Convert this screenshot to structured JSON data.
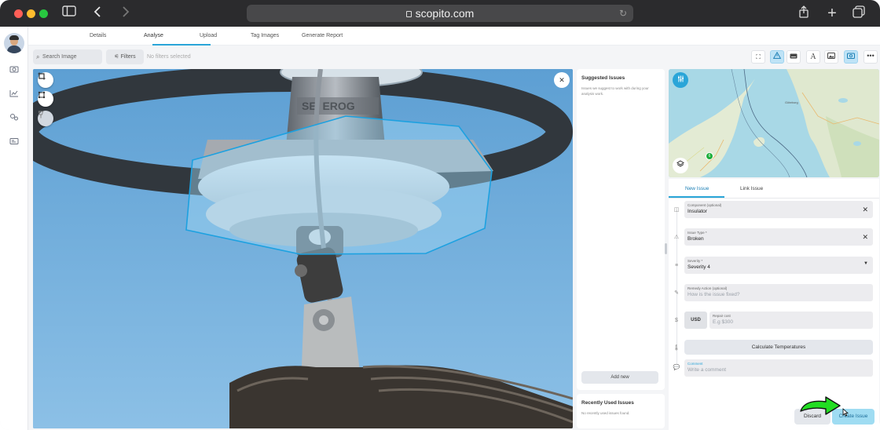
{
  "browser": {
    "url": "scopito.com"
  },
  "tabs": [
    "Details",
    "Analyse",
    "Upload",
    "Tag Images",
    "Generate Report"
  ],
  "toolbar": {
    "search_placeholder": "Search Image",
    "filters_label": "Filters",
    "no_filters": "No filters selected",
    "text_tool": "A"
  },
  "suggested": {
    "title": "Suggested Issues",
    "description": "Issues we suggest to work with during your analysis work.",
    "add_new": "Add new"
  },
  "recent": {
    "title": "Recently Used Issues",
    "description": "No recently used issues found."
  },
  "map": {
    "marker_count": "6",
    "place_label": "Göteborg"
  },
  "issue_form": {
    "tab_new": "New Issue",
    "tab_link": "Link Issue",
    "component_label": "Component (optional)",
    "component_value": "Insulator",
    "issue_type_label": "Issue Type *",
    "issue_type_value": "Broken",
    "severity_label": "Severity *",
    "severity_value": "Severity 4",
    "remedy_label": "Remedy Action (optional)",
    "remedy_placeholder": "How is the issue fixed?",
    "currency": "USD",
    "repair_cost_label": "Repair cost",
    "repair_cost_placeholder": "E.g $300",
    "calculate_label": "Calculate Temperatures",
    "comment_label": "Comment",
    "comment_placeholder": "Write a comment",
    "discard_label": "Discard",
    "create_label": "Create Issue"
  },
  "colors": {
    "accent": "#2aa5d8",
    "selection_outline": "#1da1e0",
    "annotation_arrow": "#22dd22"
  }
}
